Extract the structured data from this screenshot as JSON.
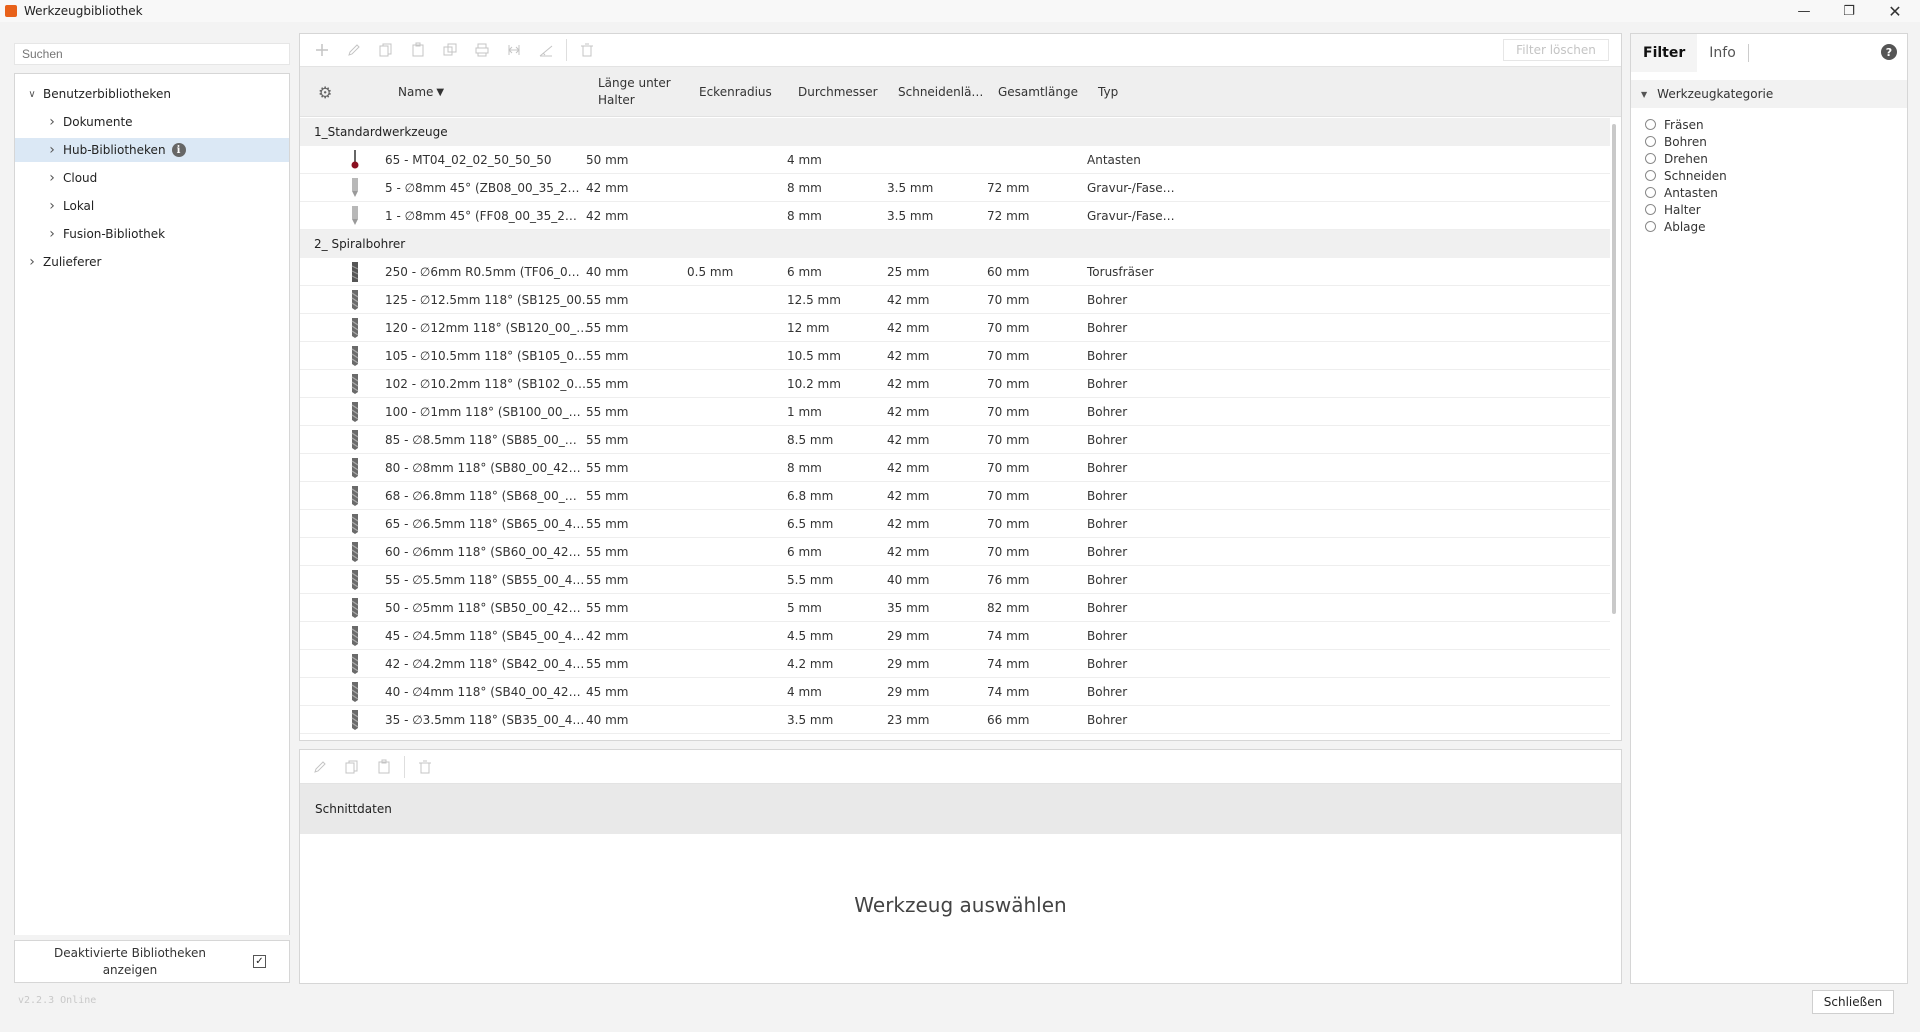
{
  "window": {
    "title": "Werkzeugbibliothek"
  },
  "left": {
    "search_placeholder": "Suchen",
    "tree": [
      {
        "label": "Benutzerbibliotheken",
        "level": 0,
        "expanded": true
      },
      {
        "label": "Dokumente",
        "level": 1
      },
      {
        "label": "Hub-Bibliotheken",
        "level": 1,
        "selected": true,
        "info": "i"
      },
      {
        "label": "Cloud",
        "level": 1
      },
      {
        "label": "Lokal",
        "level": 1
      },
      {
        "label": "Fusion-Bibliothek",
        "level": 1
      },
      {
        "label": "Zulieferer",
        "level": 0
      }
    ],
    "deactivated_label_line1": "Deaktivierte Bibliotheken",
    "deactivated_label_line2": "anzeigen",
    "deactivated_checked": true,
    "version": "v2.2.3 Online"
  },
  "toolbar": {
    "icons": [
      "add-icon",
      "edit-icon",
      "copy-icon",
      "paste-icon",
      "duplicate-icon",
      "print-icon",
      "renumber-icon",
      "measure-icon",
      "delete-icon"
    ],
    "filter_clear": "Filter löschen"
  },
  "table": {
    "headers": {
      "name": "Name",
      "length1": "Länge unter",
      "length2": "Halter",
      "corner": "Eckenradius",
      "diameter": "Durchmesser",
      "cut": "Schneidenlä…",
      "total": "Gesamtlänge",
      "type": "Typ"
    },
    "groups": [
      {
        "name": "1_Standardwerkzeuge",
        "rows": [
          {
            "icon": "probe",
            "name": "65 - MT04_02_02_50_50_50",
            "len": "50 mm",
            "corner": "",
            "dia": "4 mm",
            "cut": "",
            "total": "",
            "type": "Antasten"
          },
          {
            "icon": "engrave",
            "name": "5 - ∅8mm 45° (ZB08_00_35_2…",
            "len": "42 mm",
            "corner": "",
            "dia": "8 mm",
            "cut": "3.5 mm",
            "total": "72 mm",
            "type": "Gravur-/Fase…"
          },
          {
            "icon": "engrave",
            "name": "1 - ∅8mm 45° (FF08_00_35_2…",
            "len": "42 mm",
            "corner": "",
            "dia": "8 mm",
            "cut": "3.5 mm",
            "total": "72 mm",
            "type": "Gravur-/Fase…"
          }
        ]
      },
      {
        "name": "2_ Spiralbohrer",
        "rows": [
          {
            "icon": "torus",
            "name": "250 - ∅6mm R0.5mm (TF06_0…",
            "len": "40 mm",
            "corner": "0.5 mm",
            "dia": "6 mm",
            "cut": "25 mm",
            "total": "60 mm",
            "type": "Torusfräser"
          },
          {
            "icon": "drill",
            "name": "125 - ∅12.5mm 118° (SB125_00…",
            "len": "55 mm",
            "corner": "",
            "dia": "12.5 mm",
            "cut": "42 mm",
            "total": "70 mm",
            "type": "Bohrer"
          },
          {
            "icon": "drill",
            "name": "120 - ∅12mm 118° (SB120_00_…",
            "len": "55 mm",
            "corner": "",
            "dia": "12 mm",
            "cut": "42 mm",
            "total": "70 mm",
            "type": "Bohrer"
          },
          {
            "icon": "drill",
            "name": "105 - ∅10.5mm 118° (SB105_0…",
            "len": "55 mm",
            "corner": "",
            "dia": "10.5 mm",
            "cut": "42 mm",
            "total": "70 mm",
            "type": "Bohrer"
          },
          {
            "icon": "drill",
            "name": "102 - ∅10.2mm 118° (SB102_0…",
            "len": "55 mm",
            "corner": "",
            "dia": "10.2 mm",
            "cut": "42 mm",
            "total": "70 mm",
            "type": "Bohrer"
          },
          {
            "icon": "drill",
            "name": "100 - ∅1mm 118° (SB100_00_…",
            "len": "55 mm",
            "corner": "",
            "dia": "1 mm",
            "cut": "42 mm",
            "total": "70 mm",
            "type": "Bohrer"
          },
          {
            "icon": "drill",
            "name": "85 - ∅8.5mm 118° (SB85_00_…",
            "len": "55 mm",
            "corner": "",
            "dia": "8.5 mm",
            "cut": "42 mm",
            "total": "70 mm",
            "type": "Bohrer"
          },
          {
            "icon": "drill",
            "name": "80 - ∅8mm 118° (SB80_00_42…",
            "len": "55 mm",
            "corner": "",
            "dia": "8 mm",
            "cut": "42 mm",
            "total": "70 mm",
            "type": "Bohrer"
          },
          {
            "icon": "drill",
            "name": "68 - ∅6.8mm 118° (SB68_00_…",
            "len": "55 mm",
            "corner": "",
            "dia": "6.8 mm",
            "cut": "42 mm",
            "total": "70 mm",
            "type": "Bohrer"
          },
          {
            "icon": "drill",
            "name": "65 - ∅6.5mm 118° (SB65_00_4…",
            "len": "55 mm",
            "corner": "",
            "dia": "6.5 mm",
            "cut": "42 mm",
            "total": "70 mm",
            "type": "Bohrer"
          },
          {
            "icon": "drill",
            "name": "60 - ∅6mm 118° (SB60_00_42…",
            "len": "55 mm",
            "corner": "",
            "dia": "6 mm",
            "cut": "42 mm",
            "total": "70 mm",
            "type": "Bohrer"
          },
          {
            "icon": "drill",
            "name": "55 - ∅5.5mm 118° (SB55_00_4…",
            "len": "55 mm",
            "corner": "",
            "dia": "5.5 mm",
            "cut": "40 mm",
            "total": "76 mm",
            "type": "Bohrer"
          },
          {
            "icon": "drill",
            "name": "50 - ∅5mm 118° (SB50_00_42…",
            "len": "55 mm",
            "corner": "",
            "dia": "5 mm",
            "cut": "35 mm",
            "total": "82 mm",
            "type": "Bohrer"
          },
          {
            "icon": "drill",
            "name": "45 - ∅4.5mm 118° (SB45_00_4…",
            "len": "42 mm",
            "corner": "",
            "dia": "4.5 mm",
            "cut": "29 mm",
            "total": "74 mm",
            "type": "Bohrer"
          },
          {
            "icon": "drill",
            "name": "42 - ∅4.2mm 118° (SB42_00_4…",
            "len": "55 mm",
            "corner": "",
            "dia": "4.2 mm",
            "cut": "29 mm",
            "total": "74 mm",
            "type": "Bohrer"
          },
          {
            "icon": "drill",
            "name": "40 - ∅4mm 118° (SB40_00_42…",
            "len": "45 mm",
            "corner": "",
            "dia": "4 mm",
            "cut": "29 mm",
            "total": "74 mm",
            "type": "Bohrer"
          },
          {
            "icon": "drill",
            "name": "35 - ∅3.5mm 118° (SB35_00_4…",
            "len": "40 mm",
            "corner": "",
            "dia": "3.5 mm",
            "cut": "23 mm",
            "total": "66 mm",
            "type": "Bohrer"
          }
        ]
      }
    ]
  },
  "bottom": {
    "toolbar_icons": [
      "edit-icon",
      "copy-icon",
      "paste-icon",
      "delete-icon"
    ],
    "section_title": "Schnittdaten",
    "empty_text": "Werkzeug auswählen"
  },
  "right": {
    "tabs": [
      "Filter",
      "Info"
    ],
    "active_tab": "Filter",
    "help": "?",
    "category_title": "Werkzeugkategorie",
    "categories": [
      "Fräsen",
      "Bohren",
      "Drehen",
      "Schneiden",
      "Antasten",
      "Halter",
      "Ablage"
    ]
  },
  "close_button": "Schließen"
}
